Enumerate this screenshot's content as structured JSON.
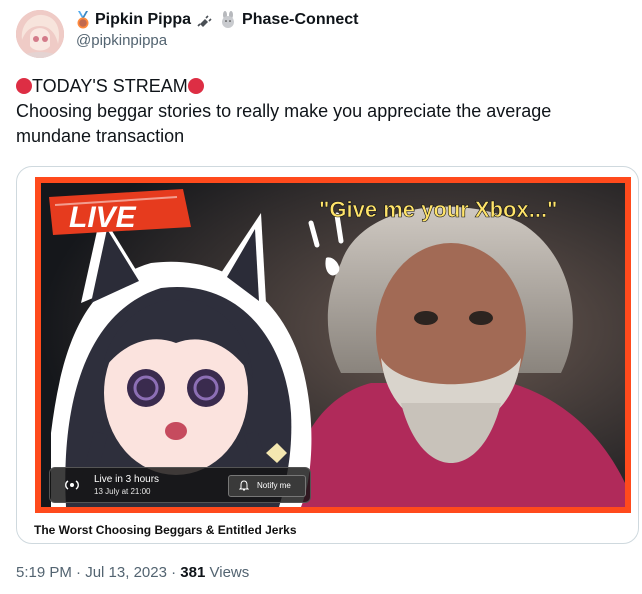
{
  "user": {
    "name": "Pipkin Pippa",
    "org": "Phase-Connect",
    "handle": "@pipkinpippa"
  },
  "tweet": {
    "headline": "TODAY'S STREAM",
    "body": "Choosing beggar stories to really make you appreciate the average mundane transaction"
  },
  "media": {
    "live_badge": "LIVE",
    "quote": "\"Give me your Xbox...\"",
    "live_status": "Live in 3 hours",
    "live_time": "13 July at 21:00",
    "notify_label": "Notify me",
    "video_title": "The Worst Choosing Beggars & Entitled Jerks"
  },
  "meta": {
    "time": "5:19 PM",
    "date": "Jul 13, 2023",
    "views_count": "381",
    "views_label": "Views"
  },
  "colors": {
    "thumb_border": "#ff4a1c",
    "live_red": "#dd2e44",
    "secondary_text": "#536471"
  }
}
